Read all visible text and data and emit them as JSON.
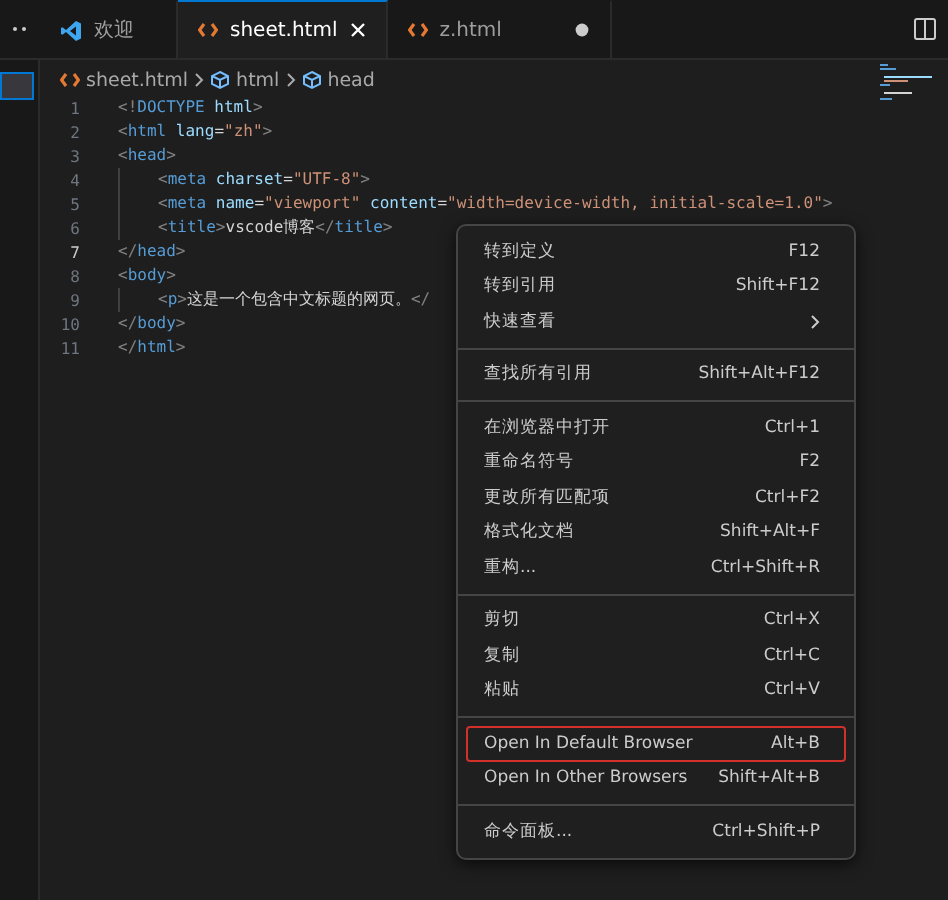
{
  "tabs": [
    {
      "label": "欢迎",
      "kind": "welcome",
      "selected": false,
      "modified": false
    },
    {
      "label": "sheet.html",
      "kind": "html",
      "selected": true,
      "modified": false
    },
    {
      "label": "z.html",
      "kind": "html",
      "selected": false,
      "modified": true
    }
  ],
  "breadcrumb": [
    {
      "label": "sheet.html",
      "kind": "file"
    },
    {
      "label": "html",
      "kind": "element"
    },
    {
      "label": "head",
      "kind": "element"
    }
  ],
  "editor": {
    "lines": [
      {
        "number": "1",
        "current": false,
        "indent": false,
        "tokens": [
          {
            "kind": "punct",
            "text": "<!"
          },
          {
            "kind": "tag",
            "text": "DOCTYPE"
          },
          {
            "kind": "attr",
            "text": " html"
          },
          {
            "kind": "punct",
            "text": ">"
          }
        ]
      },
      {
        "number": "2",
        "current": false,
        "indent": false,
        "tokens": [
          {
            "kind": "punct",
            "text": "<"
          },
          {
            "kind": "tag",
            "text": "html"
          },
          {
            "kind": "attr",
            "text": " lang"
          },
          {
            "kind": "text",
            "text": "="
          },
          {
            "kind": "string",
            "text": "\"zh\""
          },
          {
            "kind": "punct",
            "text": ">"
          }
        ]
      },
      {
        "number": "3",
        "current": false,
        "indent": false,
        "tokens": [
          {
            "kind": "punct",
            "text": "<"
          },
          {
            "kind": "tag",
            "text": "head"
          },
          {
            "kind": "punct",
            "text": ">"
          }
        ]
      },
      {
        "number": "4",
        "current": false,
        "indent": true,
        "tokens": [
          {
            "kind": "punct",
            "text": "<"
          },
          {
            "kind": "tag",
            "text": "meta"
          },
          {
            "kind": "attr",
            "text": " charset"
          },
          {
            "kind": "text",
            "text": "="
          },
          {
            "kind": "string",
            "text": "\"UTF-8\""
          },
          {
            "kind": "punct",
            "text": ">"
          }
        ]
      },
      {
        "number": "5",
        "current": false,
        "indent": true,
        "tokens": [
          {
            "kind": "punct",
            "text": "<"
          },
          {
            "kind": "tag",
            "text": "meta"
          },
          {
            "kind": "attr",
            "text": " name"
          },
          {
            "kind": "text",
            "text": "="
          },
          {
            "kind": "string",
            "text": "\"viewport\""
          },
          {
            "kind": "attr",
            "text": " content"
          },
          {
            "kind": "text",
            "text": "="
          },
          {
            "kind": "string",
            "text": "\"width=device-width, initial-scale=1.0\""
          },
          {
            "kind": "punct",
            "text": ">"
          }
        ]
      },
      {
        "number": "6",
        "current": false,
        "indent": true,
        "tokens": [
          {
            "kind": "punct",
            "text": "<"
          },
          {
            "kind": "tag",
            "text": "title"
          },
          {
            "kind": "punct",
            "text": ">"
          },
          {
            "kind": "text",
            "text": "vscode博客"
          },
          {
            "kind": "punct",
            "text": "</"
          },
          {
            "kind": "tag",
            "text": "title"
          },
          {
            "kind": "punct",
            "text": ">"
          }
        ]
      },
      {
        "number": "7",
        "current": true,
        "indent": false,
        "tokens": [
          {
            "kind": "punct",
            "text": "</"
          },
          {
            "kind": "tag",
            "text": "head"
          },
          {
            "kind": "punct",
            "text": ">"
          }
        ]
      },
      {
        "number": "8",
        "current": false,
        "indent": false,
        "tokens": [
          {
            "kind": "punct",
            "text": "<"
          },
          {
            "kind": "tag",
            "text": "body"
          },
          {
            "kind": "punct",
            "text": ">"
          }
        ]
      },
      {
        "number": "9",
        "current": false,
        "indent": true,
        "tokens": [
          {
            "kind": "punct",
            "text": "<"
          },
          {
            "kind": "tag",
            "text": "p"
          },
          {
            "kind": "punct",
            "text": ">"
          },
          {
            "kind": "text",
            "text": "这是一个包含中文标题的网页。"
          },
          {
            "kind": "punct",
            "text": "</"
          }
        ]
      },
      {
        "number": "10",
        "current": false,
        "indent": false,
        "tokens": [
          {
            "kind": "punct",
            "text": "</"
          },
          {
            "kind": "tag",
            "text": "body"
          },
          {
            "kind": "punct",
            "text": ">"
          }
        ]
      },
      {
        "number": "11",
        "current": false,
        "indent": false,
        "tokens": [
          {
            "kind": "punct",
            "text": "</"
          },
          {
            "kind": "tag",
            "text": "html"
          },
          {
            "kind": "punct",
            "text": ">"
          }
        ]
      }
    ]
  },
  "context_menu": {
    "groups": [
      [
        {
          "label": "转到定义",
          "shortcut": "F12",
          "submenu": false,
          "selected": false
        },
        {
          "label": "转到引用",
          "shortcut": "Shift+F12",
          "submenu": false,
          "selected": false
        },
        {
          "label": "快速查看",
          "submenu": true,
          "selected": false
        }
      ],
      [
        {
          "label": "查找所有引用",
          "shortcut": "Shift+Alt+F12",
          "submenu": false,
          "selected": false
        }
      ],
      [
        {
          "label": "在浏览器中打开",
          "shortcut": "Ctrl+1",
          "submenu": false,
          "selected": false
        },
        {
          "label": "重命名符号",
          "shortcut": "F2",
          "submenu": false,
          "selected": false
        },
        {
          "label": "更改所有匹配项",
          "shortcut": "Ctrl+F2",
          "submenu": false,
          "selected": false
        },
        {
          "label": "格式化文档",
          "shortcut": "Shift+Alt+F",
          "submenu": false,
          "selected": false
        },
        {
          "label": "重构...",
          "shortcut": "Ctrl+Shift+R",
          "submenu": false,
          "selected": false
        }
      ],
      [
        {
          "label": "剪切",
          "shortcut": "Ctrl+X",
          "submenu": false,
          "selected": false
        },
        {
          "label": "复制",
          "shortcut": "Ctrl+C",
          "submenu": false,
          "selected": false
        },
        {
          "label": "粘贴",
          "shortcut": "Ctrl+V",
          "submenu": false,
          "selected": false
        }
      ],
      [
        {
          "label": "Open In Default Browser",
          "shortcut": "Alt+B",
          "submenu": false,
          "selected": true
        },
        {
          "label": "Open In Other Browsers",
          "shortcut": "Shift+Alt+B",
          "submenu": false,
          "selected": false
        }
      ],
      [
        {
          "label": "命令面板...",
          "shortcut": "Ctrl+Shift+P",
          "submenu": false,
          "selected": false
        }
      ]
    ]
  }
}
